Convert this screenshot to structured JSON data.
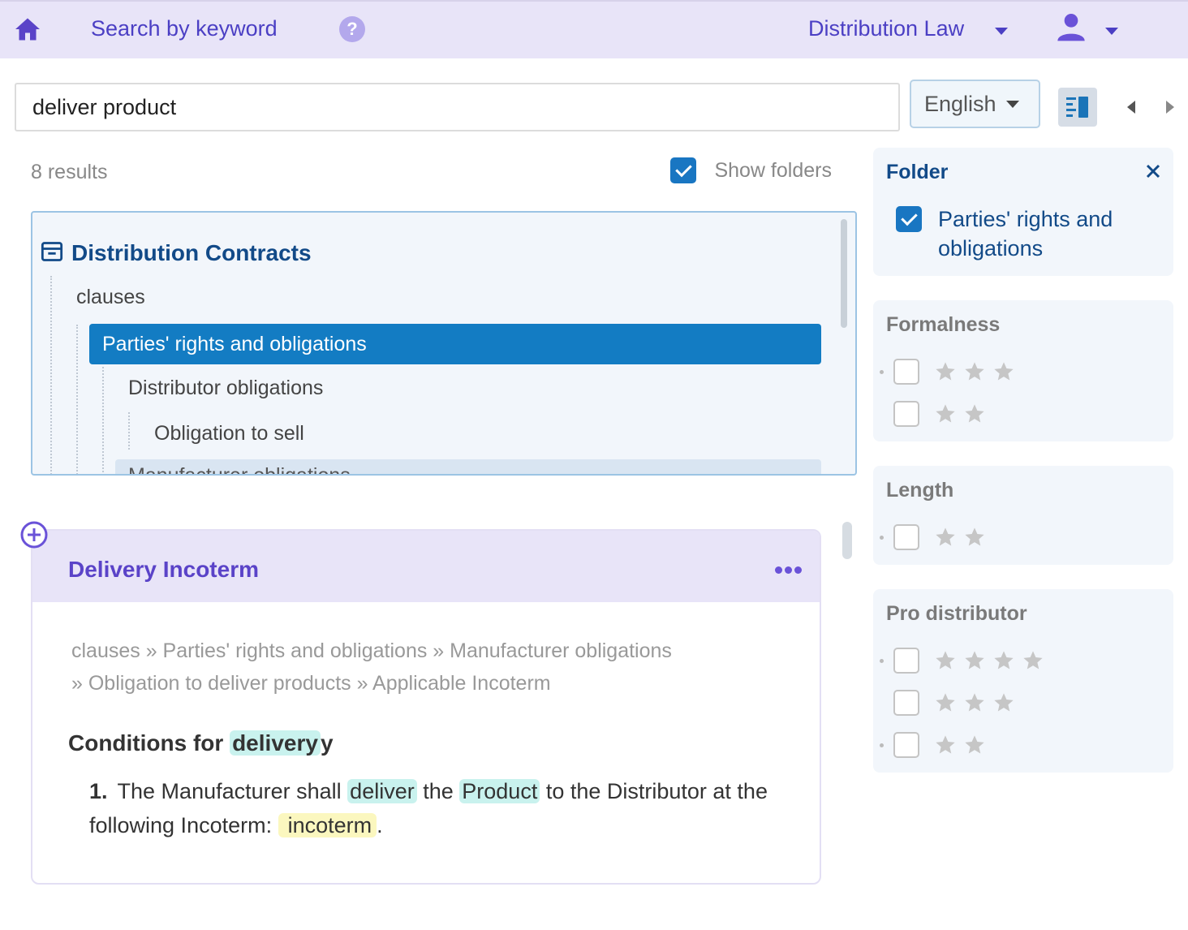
{
  "topbar": {
    "search_link": "Search by keyword",
    "help_glyph": "?",
    "law_selector": "Distribution Law",
    "icons": [
      "home-icon",
      "help-icon",
      "chevron-down-icon",
      "user-icon"
    ]
  },
  "search": {
    "query": "deliver product",
    "language": "English",
    "icons": [
      "layout-toggle-icon",
      "chevron-left-icon",
      "chevron-right-icon"
    ]
  },
  "results": {
    "count_label": "8 results",
    "show_folders_label": "Show folders",
    "show_folders_checked": true
  },
  "tree": {
    "root": "Distribution Contracts",
    "nodes": [
      {
        "label": "clauses",
        "level": 1
      },
      {
        "label": "Parties' rights and obligations",
        "level": 2,
        "selected": true
      },
      {
        "label": "Distributor obligations",
        "level": 3
      },
      {
        "label": "Obligation to sell",
        "level": 4
      },
      {
        "label": "Manufacturer obligations",
        "level": 3,
        "partially_visible": true
      }
    ]
  },
  "result_card": {
    "title": "Delivery Incoterm",
    "breadcrumb_line1": "clauses » Parties' rights and obligations » Manufacturer obligations",
    "breadcrumb_line2": "» Obligation to deliver products » Applicable Incoterm",
    "clause_title_prefix": "Conditions for ",
    "clause_title_highlight": "delivery",
    "clause_title_suffix": "y",
    "paragraph": {
      "number": "1.",
      "t1": "The Manufacturer shall ",
      "h1": "deliver",
      "t2": " the ",
      "h2": "Product",
      "t3": " to the Distributor at the following Incoterm: ",
      "h3": "incoterm",
      "t4": "."
    }
  },
  "filters": {
    "folder": {
      "title": "Folder",
      "option": "Parties' rights and obligations",
      "checked": true
    },
    "formalness": {
      "title": "Formalness",
      "options": [
        3,
        2
      ]
    },
    "length": {
      "title": "Length",
      "options": [
        2
      ]
    },
    "pro_distributor": {
      "title": "Pro distributor",
      "options": [
        4,
        3,
        2
      ]
    }
  },
  "colors": {
    "accent_purple": "#5a43c8",
    "accent_blue": "#137cc3",
    "topbar_bg": "#e8e4f8",
    "highlight_cyan": "#c9f2ee",
    "highlight_yellow": "#fbf7bf"
  }
}
